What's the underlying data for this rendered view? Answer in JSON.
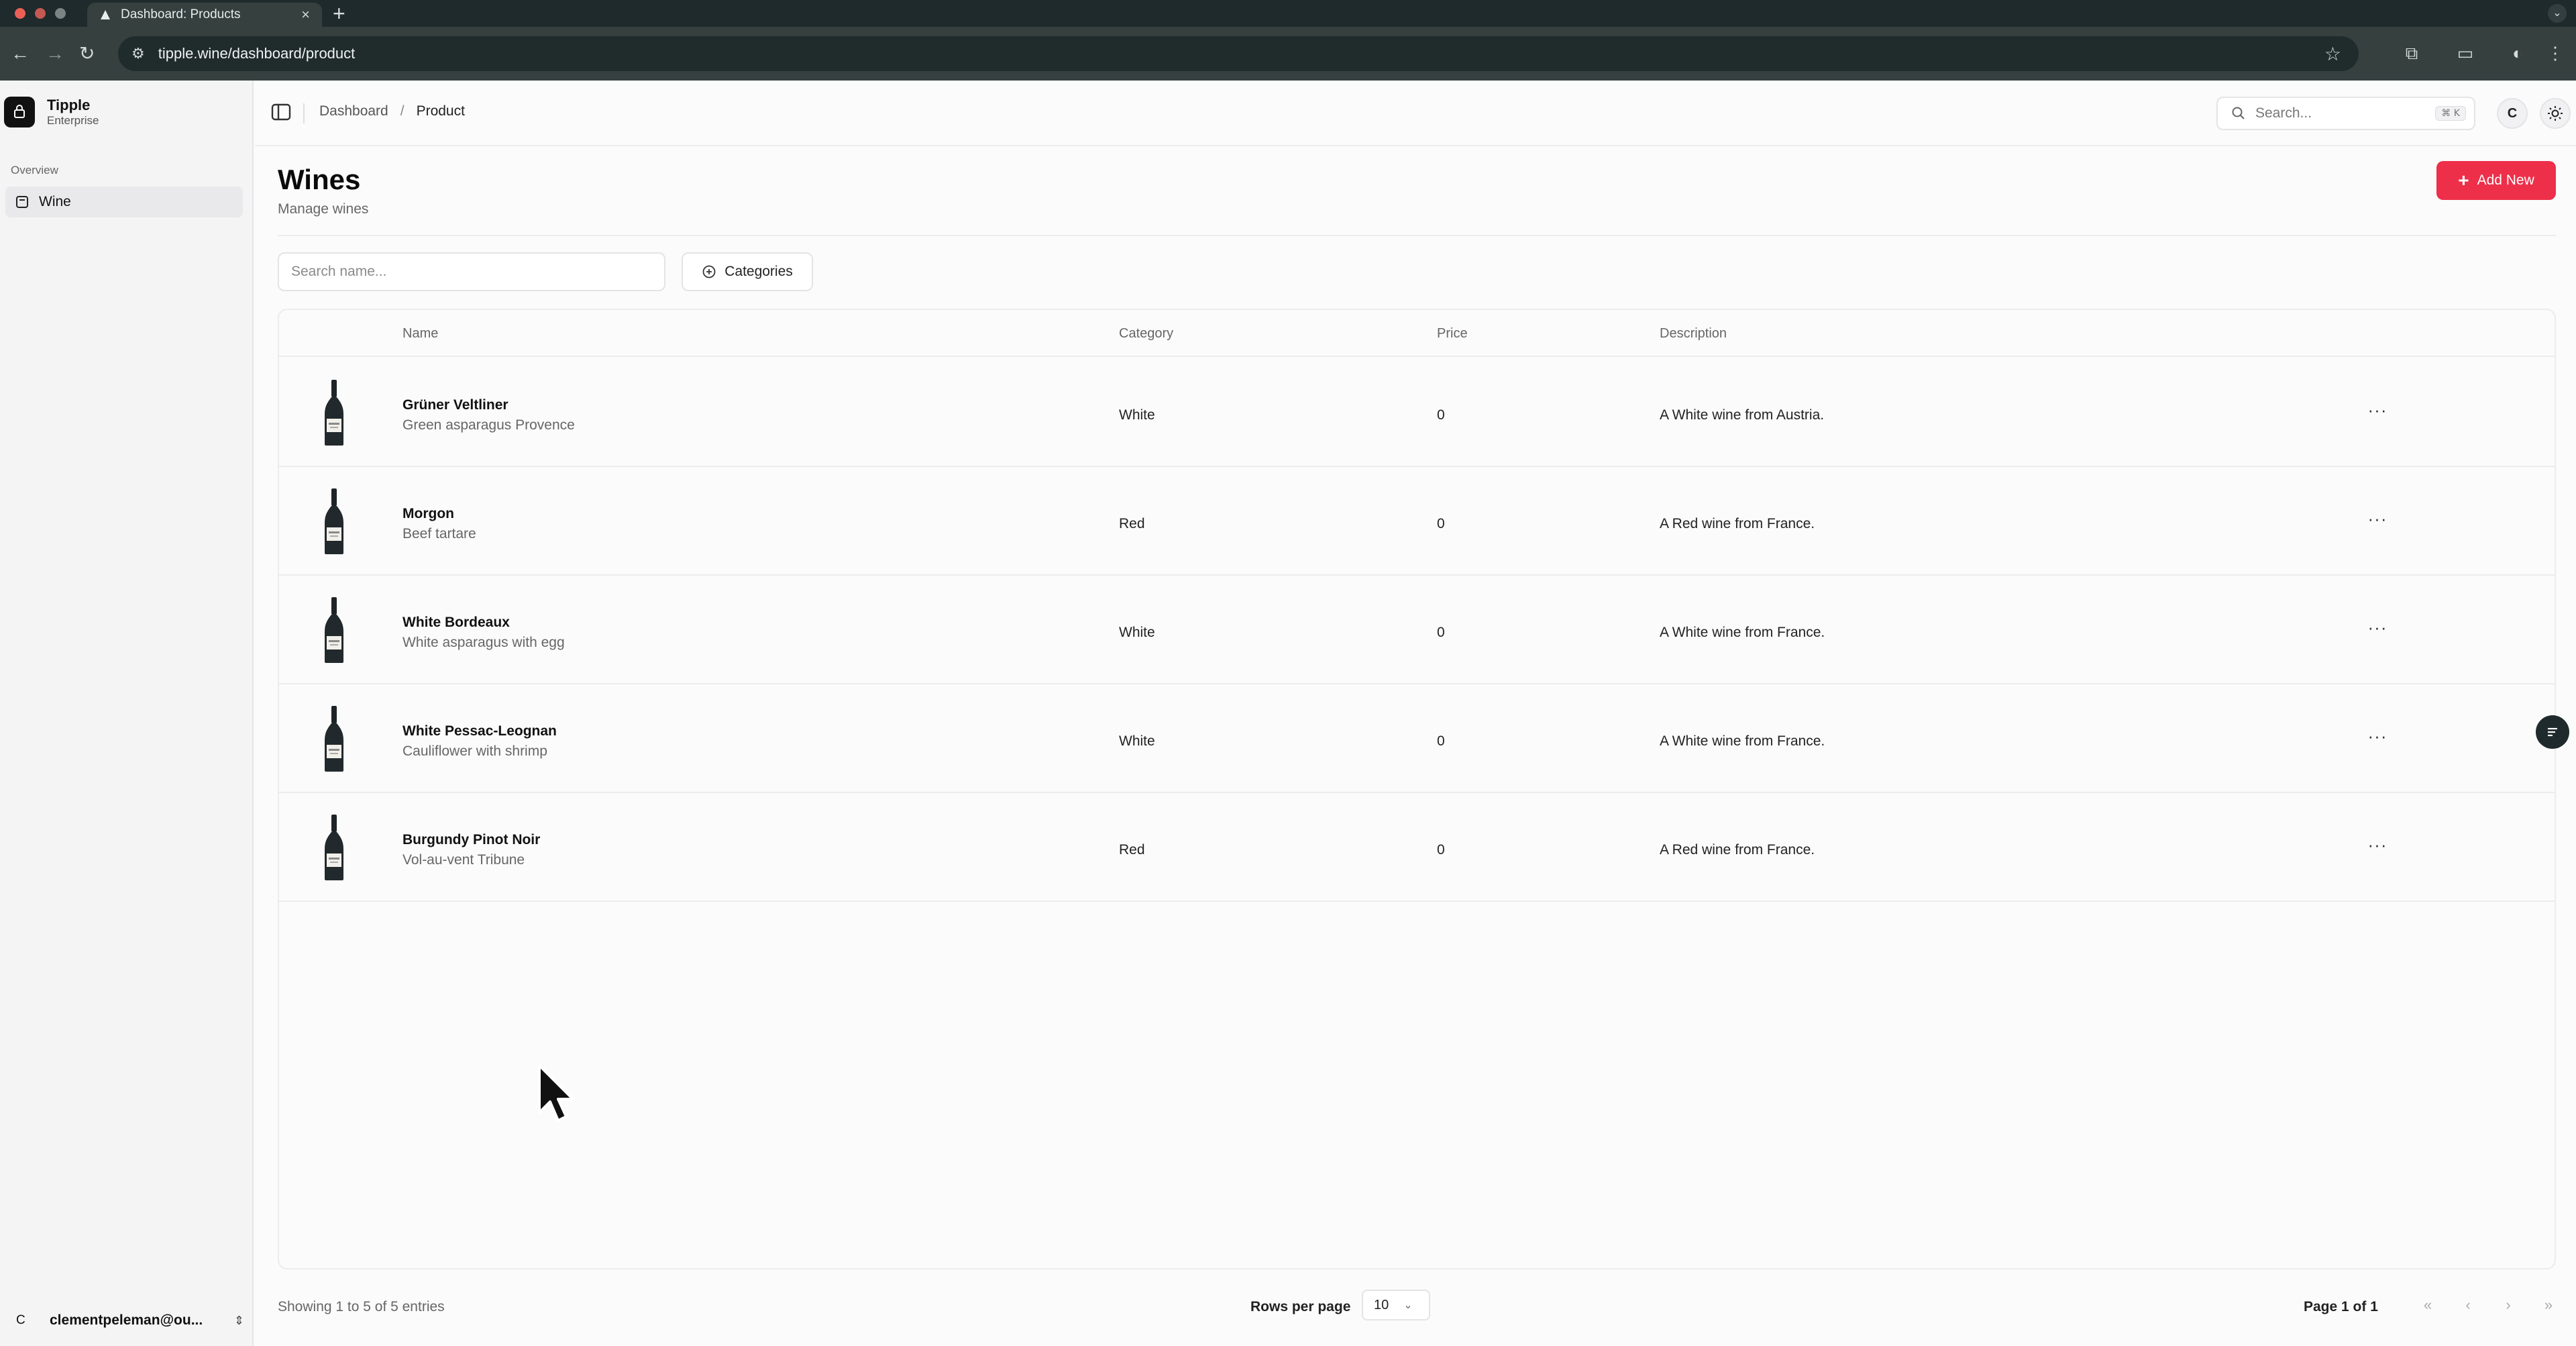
{
  "browser": {
    "tab_title": "Dashboard: Products",
    "tab_close": "×",
    "new_tab": "+",
    "url": "tipple.wine/dashboard/product"
  },
  "sidebar": {
    "brand_initial": "",
    "brand_name": "Tipple",
    "brand_plan": "Enterprise",
    "group_label": "Overview",
    "items": [
      {
        "label": "Wine",
        "icon": "wine-box-icon"
      }
    ],
    "user": {
      "initial": "C",
      "email": "clementpeleman@ou..."
    }
  },
  "header": {
    "breadcrumbs": [
      "Dashboard",
      "Product"
    ],
    "breadcrumb_separator": "/",
    "search_placeholder": "Search...",
    "search_shortcut": "⌘ K",
    "avatar_initial": "C"
  },
  "page": {
    "title": "Wines",
    "subtitle": "Manage wines",
    "add_button": "Add New",
    "add_icon": "+"
  },
  "filters": {
    "name_placeholder": "Search name...",
    "categories_label": "Categories"
  },
  "table": {
    "columns": [
      "Name",
      "Category",
      "Price",
      "Description"
    ],
    "rows": [
      {
        "name": "Grüner Veltliner",
        "pairing": "Green asparagus Provence",
        "category": "White",
        "price": "0",
        "description": "A White wine from Austria."
      },
      {
        "name": "Morgon",
        "pairing": "Beef tartare",
        "category": "Red",
        "price": "0",
        "description": "A Red wine from France."
      },
      {
        "name": "White Bordeaux",
        "pairing": "White asparagus with egg",
        "category": "White",
        "price": "0",
        "description": "A White wine from France."
      },
      {
        "name": "White Pessac-Leognan",
        "pairing": "Cauliflower with shrimp",
        "category": "White",
        "price": "0",
        "description": "A White wine from France."
      },
      {
        "name": "Burgundy Pinot Noir",
        "pairing": "Vol-au-vent Tribune",
        "category": "Red",
        "price": "0",
        "description": "A Red wine from France."
      }
    ],
    "row_action": "···"
  },
  "footer": {
    "entries_text": "Showing 1 to 5 of 5 entries",
    "rows_per_page_label": "Rows per page",
    "rows_per_page_value": "10",
    "page_info": "Page 1 of 1",
    "pager": {
      "first": "«",
      "prev": "‹",
      "next": "›",
      "last": "»"
    }
  },
  "colors": {
    "accent": "#ee2f4a",
    "browser_dark": "#1f2a2c",
    "sidebar_bg": "#f4f4f5"
  }
}
